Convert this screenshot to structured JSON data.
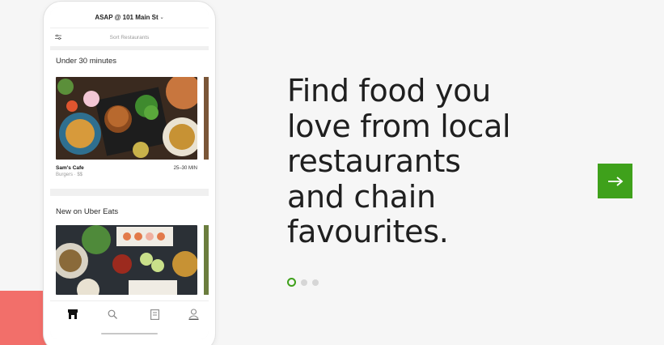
{
  "phone": {
    "header_label": "ASAP @ 101 Main St",
    "sort_label": "Sort Restaurants",
    "section1": {
      "title": "Under 30 minutes",
      "card": {
        "name": "Sam's Cafe",
        "time": "25–30 MIN",
        "subtitle": "Burgers · $$"
      }
    },
    "section2": {
      "title": "New on Uber Eats"
    },
    "tabs": [
      "store-icon",
      "search-icon",
      "orders-icon",
      "account-icon"
    ]
  },
  "hero": {
    "headline_lines": [
      "Find food you",
      "love from local",
      "restaurants",
      "and chain",
      "favourites."
    ]
  },
  "carousel": {
    "active_index": 0,
    "count": 3
  },
  "colors": {
    "accent_green": "#3fa11b",
    "accent_salmon": "#f26f6a",
    "background": "#f6f6f6"
  },
  "next_button": {
    "icon": "arrow-right-icon"
  }
}
